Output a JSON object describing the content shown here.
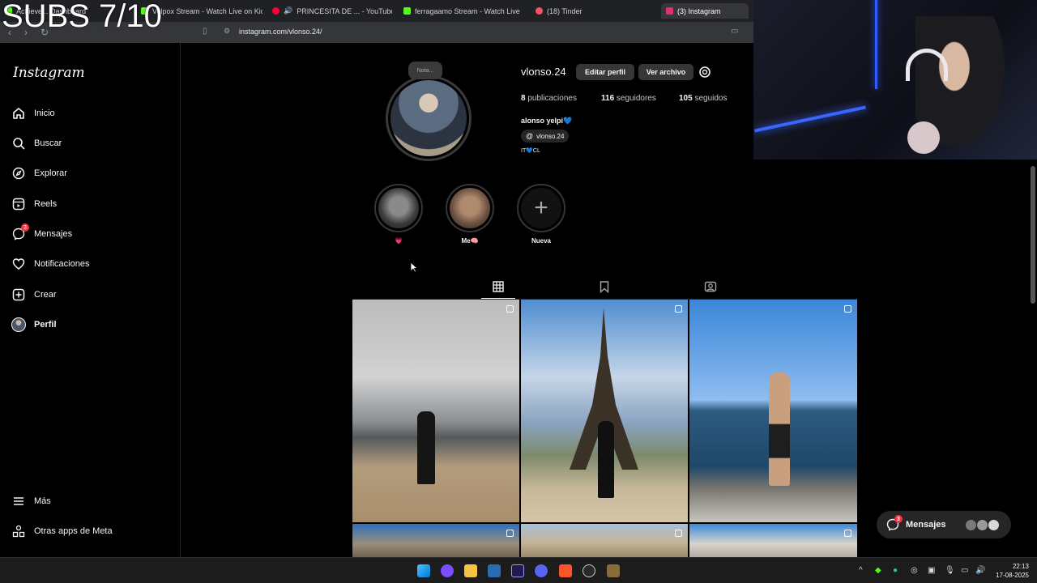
{
  "overlay": {
    "subs_text": "SUBS 7/10"
  },
  "browser": {
    "tabs": [
      {
        "label": "Achieve... Dashboard",
        "color": "#53fc18"
      },
      {
        "label": "Velpox Stream - Watch Live on Kick",
        "color": "#53fc18"
      },
      {
        "label": "PRINCESITA DE ... - YouTube Mu",
        "color": "#ff0033"
      },
      {
        "label": "ferragaamo Stream - Watch Live on I",
        "color": "#53fc18"
      },
      {
        "label": "(18) Tinder",
        "color": "#fd5068"
      },
      {
        "label": "(3) Instagram",
        "color": "#e1306c"
      }
    ],
    "url": "instagram.com/vlonso.24/"
  },
  "sidebar": {
    "logo": "Instagram",
    "items": [
      {
        "label": "Inicio",
        "icon": "home-icon"
      },
      {
        "label": "Buscar",
        "icon": "search-icon"
      },
      {
        "label": "Explorar",
        "icon": "explore-icon"
      },
      {
        "label": "Reels",
        "icon": "reels-icon"
      },
      {
        "label": "Mensajes",
        "icon": "messenger-icon",
        "badge": "3"
      },
      {
        "label": "Notificaciones",
        "icon": "heart-icon"
      },
      {
        "label": "Crear",
        "icon": "plus-square-icon"
      },
      {
        "label": "Perfil",
        "icon": "avatar"
      }
    ],
    "more": "Más",
    "meta_apps": "Otras apps de Meta"
  },
  "profile": {
    "note": "Nota...",
    "username": "vlonso.24",
    "edit_button": "Editar perfil",
    "archive_button": "Ver archivo",
    "posts_count": "8",
    "posts_label": "publicaciones",
    "followers_count": "116",
    "followers_label": "seguidores",
    "following_count": "105",
    "following_label": "seguidos",
    "full_name": "alonso yelpi💙",
    "threads_handle": "vlonso.24",
    "bio": "IT💙CL"
  },
  "highlights": [
    {
      "label": "💗"
    },
    {
      "label": "Me🧠"
    },
    {
      "label": "Nueva"
    }
  ],
  "messages_pill": {
    "label": "Mensajes",
    "badge": "3"
  },
  "taskbar": {
    "time": "22:13",
    "date": "17-08-2025"
  }
}
